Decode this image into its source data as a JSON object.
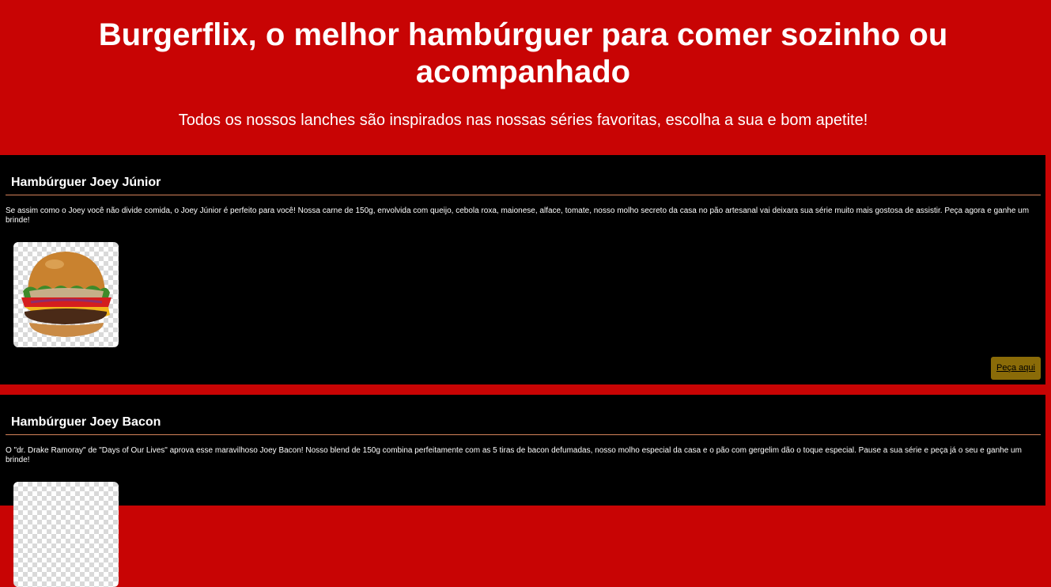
{
  "header": {
    "title": "Burgerflix, o melhor hambúrguer para comer sozinho ou acompanhado",
    "subtitle": "Todos os nossos lanches são inspirados nas nossas séries favoritas, escolha a sua e bom apetite!"
  },
  "products": [
    {
      "name": "Hambúrguer Joey Júnior",
      "description": "Se assim como o Joey você não divide comida, o Joey Júnior é perfeito para você! Nossa carne de 150g, envolvida com queijo, cebola roxa, maionese, alface, tomate, nosso molho secreto da casa no pão artesanal vai deixara sua série muito mais gostosa de assistir. Peça agora e ganhe um brinde!",
      "order_label": "Peça aqui"
    },
    {
      "name": "Hambúrguer Joey Bacon",
      "description": "O \"dr. Drake Ramoray\" de \"Days of Our Lives\" aprova esse maravilhoso Joey Bacon! Nosso blend de 150g combina perfeitamente com as 5 tiras de bacon defumadas, nosso molho especial da casa e o pão com gergelim dão o toque especial. Pause a sua série e peça já o seu e ganhe um brinde!"
    }
  ],
  "colors": {
    "brand_red": "#c80404",
    "card_bg": "#000000",
    "divider": "#d4825a",
    "button_bg": "#8a6b08"
  },
  "icons": {
    "product_image": "burger-image"
  }
}
